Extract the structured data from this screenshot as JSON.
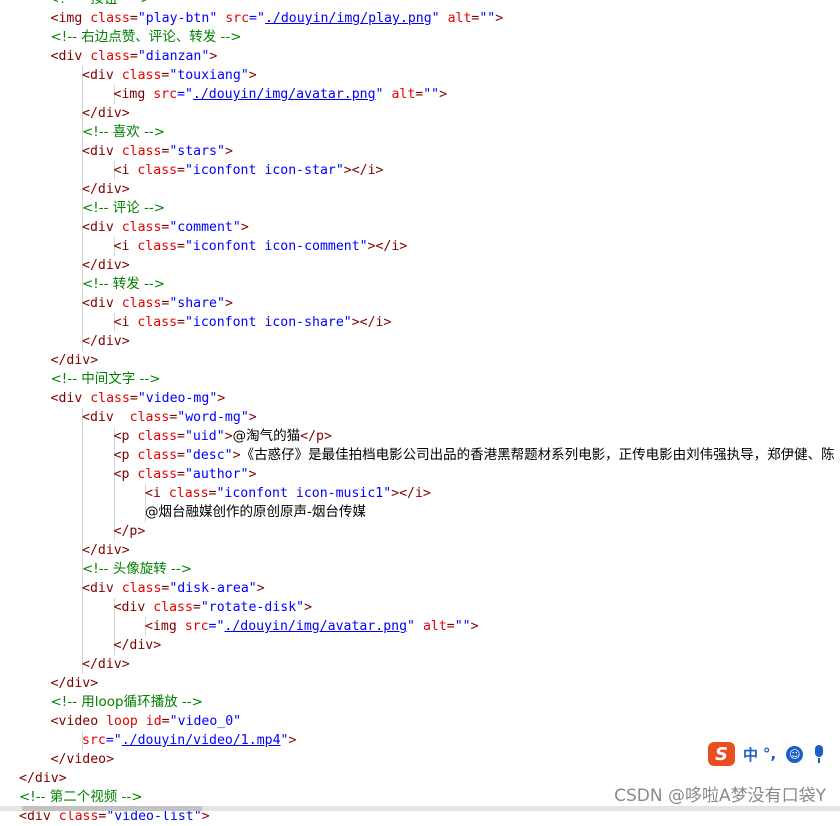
{
  "editor": {
    "lines": [
      {
        "indent": 1,
        "tokens": [
          {
            "t": "<!-- ",
            "c": "comment"
          },
          {
            "t": "按钮",
            "c": "comment"
          },
          {
            "t": " -->",
            "c": "comment"
          }
        ]
      },
      {
        "indent": 1,
        "tokens": [
          {
            "t": "<img ",
            "c": "tag"
          },
          {
            "t": "class",
            "c": "attr"
          },
          {
            "t": "=",
            "c": "tag"
          },
          {
            "t": "\"play-btn\"",
            "c": "str"
          },
          {
            "t": " ",
            "c": "tag"
          },
          {
            "t": "src",
            "c": "attr"
          },
          {
            "t": "=\"",
            "c": "str"
          },
          {
            "t": "./douyin/img/play.png",
            "c": "link"
          },
          {
            "t": "\"",
            "c": "str"
          },
          {
            "t": " ",
            "c": "tag"
          },
          {
            "t": "alt",
            "c": "attr"
          },
          {
            "t": "=",
            "c": "tag"
          },
          {
            "t": "\"\"",
            "c": "str"
          },
          {
            "t": ">",
            "c": "tag"
          }
        ]
      },
      {
        "indent": 1,
        "tokens": [
          {
            "t": "<!-- 右边点赞、评论、转发 -->",
            "c": "comment"
          }
        ]
      },
      {
        "indent": 1,
        "tokens": [
          {
            "t": "<div ",
            "c": "tag"
          },
          {
            "t": "class",
            "c": "attr"
          },
          {
            "t": "=",
            "c": "tag"
          },
          {
            "t": "\"dianzan\"",
            "c": "str"
          },
          {
            "t": ">",
            "c": "tag"
          }
        ]
      },
      {
        "indent": 2,
        "tokens": [
          {
            "t": "<div ",
            "c": "tag"
          },
          {
            "t": "class",
            "c": "attr"
          },
          {
            "t": "=",
            "c": "tag"
          },
          {
            "t": "\"touxiang\"",
            "c": "str"
          },
          {
            "t": ">",
            "c": "tag"
          }
        ]
      },
      {
        "indent": 3,
        "tokens": [
          {
            "t": "<img ",
            "c": "tag"
          },
          {
            "t": "src",
            "c": "attr"
          },
          {
            "t": "=\"",
            "c": "str"
          },
          {
            "t": "./douyin/img/avatar.png",
            "c": "link"
          },
          {
            "t": "\"",
            "c": "str"
          },
          {
            "t": " ",
            "c": "tag"
          },
          {
            "t": "alt",
            "c": "attr"
          },
          {
            "t": "=",
            "c": "tag"
          },
          {
            "t": "\"\"",
            "c": "str"
          },
          {
            "t": ">",
            "c": "tag"
          }
        ]
      },
      {
        "indent": 2,
        "tokens": [
          {
            "t": "</div>",
            "c": "tag"
          }
        ]
      },
      {
        "indent": 2,
        "tokens": [
          {
            "t": "<!-- 喜欢 -->",
            "c": "comment"
          }
        ]
      },
      {
        "indent": 2,
        "tokens": [
          {
            "t": "<div ",
            "c": "tag"
          },
          {
            "t": "class",
            "c": "attr"
          },
          {
            "t": "=",
            "c": "tag"
          },
          {
            "t": "\"stars\"",
            "c": "str"
          },
          {
            "t": ">",
            "c": "tag"
          }
        ]
      },
      {
        "indent": 3,
        "tokens": [
          {
            "t": "<i ",
            "c": "tag"
          },
          {
            "t": "class",
            "c": "attr"
          },
          {
            "t": "=",
            "c": "tag"
          },
          {
            "t": "\"iconfont icon-star\"",
            "c": "str"
          },
          {
            "t": "></i>",
            "c": "tag"
          }
        ]
      },
      {
        "indent": 2,
        "tokens": [
          {
            "t": "</div>",
            "c": "tag"
          }
        ]
      },
      {
        "indent": 2,
        "tokens": [
          {
            "t": "<!-- 评论 -->",
            "c": "comment"
          }
        ]
      },
      {
        "indent": 2,
        "tokens": [
          {
            "t": "<div ",
            "c": "tag"
          },
          {
            "t": "class",
            "c": "attr"
          },
          {
            "t": "=",
            "c": "tag"
          },
          {
            "t": "\"comment\"",
            "c": "str"
          },
          {
            "t": ">",
            "c": "tag"
          }
        ]
      },
      {
        "indent": 3,
        "tokens": [
          {
            "t": "<i ",
            "c": "tag"
          },
          {
            "t": "class",
            "c": "attr"
          },
          {
            "t": "=",
            "c": "tag"
          },
          {
            "t": "\"iconfont icon-comment\"",
            "c": "str"
          },
          {
            "t": "></i>",
            "c": "tag"
          }
        ]
      },
      {
        "indent": 2,
        "tokens": [
          {
            "t": "</div>",
            "c": "tag"
          }
        ]
      },
      {
        "indent": 2,
        "tokens": [
          {
            "t": "<!-- 转发 -->",
            "c": "comment"
          }
        ]
      },
      {
        "indent": 2,
        "tokens": [
          {
            "t": "<div ",
            "c": "tag"
          },
          {
            "t": "class",
            "c": "attr"
          },
          {
            "t": "=",
            "c": "tag"
          },
          {
            "t": "\"share\"",
            "c": "str"
          },
          {
            "t": ">",
            "c": "tag"
          }
        ]
      },
      {
        "indent": 3,
        "tokens": [
          {
            "t": "<i ",
            "c": "tag"
          },
          {
            "t": "class",
            "c": "attr"
          },
          {
            "t": "=",
            "c": "tag"
          },
          {
            "t": "\"iconfont icon-share\"",
            "c": "str"
          },
          {
            "t": "></i>",
            "c": "tag"
          }
        ]
      },
      {
        "indent": 2,
        "tokens": [
          {
            "t": "</div>",
            "c": "tag"
          }
        ]
      },
      {
        "indent": 1,
        "tokens": [
          {
            "t": "</div>",
            "c": "tag"
          }
        ]
      },
      {
        "indent": 1,
        "tokens": [
          {
            "t": "<!-- 中间文字 -->",
            "c": "comment"
          }
        ]
      },
      {
        "indent": 1,
        "tokens": [
          {
            "t": "<div ",
            "c": "tag"
          },
          {
            "t": "class",
            "c": "attr"
          },
          {
            "t": "=",
            "c": "tag"
          },
          {
            "t": "\"video-mg\"",
            "c": "str"
          },
          {
            "t": ">",
            "c": "tag"
          }
        ]
      },
      {
        "indent": 2,
        "tokens": [
          {
            "t": "<div  ",
            "c": "tag"
          },
          {
            "t": "class",
            "c": "attr"
          },
          {
            "t": "=",
            "c": "tag"
          },
          {
            "t": "\"word-mg\"",
            "c": "str"
          },
          {
            "t": ">",
            "c": "tag"
          }
        ]
      },
      {
        "indent": 3,
        "tokens": [
          {
            "t": "<p ",
            "c": "tag"
          },
          {
            "t": "class",
            "c": "attr"
          },
          {
            "t": "=",
            "c": "tag"
          },
          {
            "t": "\"uid\"",
            "c": "str"
          },
          {
            "t": ">",
            "c": "tag"
          },
          {
            "t": "@淘气的猫",
            "c": "text"
          },
          {
            "t": "</p>",
            "c": "tag"
          }
        ]
      },
      {
        "indent": 3,
        "tokens": [
          {
            "t": "<p ",
            "c": "tag"
          },
          {
            "t": "class",
            "c": "attr"
          },
          {
            "t": "=",
            "c": "tag"
          },
          {
            "t": "\"desc\"",
            "c": "str"
          },
          {
            "t": ">",
            "c": "tag"
          },
          {
            "t": "《古惑仔》是最佳拍档电影公司出品的香港黑帮题材系列电影，正传电影由刘伟强执导，郑伊健、陈",
            "c": "text"
          }
        ]
      },
      {
        "indent": 3,
        "tokens": [
          {
            "t": "<p ",
            "c": "tag"
          },
          {
            "t": "class",
            "c": "attr"
          },
          {
            "t": "=",
            "c": "tag"
          },
          {
            "t": "\"author\"",
            "c": "str"
          },
          {
            "t": ">",
            "c": "tag"
          }
        ]
      },
      {
        "indent": 4,
        "tokens": [
          {
            "t": "<i ",
            "c": "tag"
          },
          {
            "t": "class",
            "c": "attr"
          },
          {
            "t": "=",
            "c": "tag"
          },
          {
            "t": "\"iconfont icon-music1\"",
            "c": "str"
          },
          {
            "t": "></i>",
            "c": "tag"
          }
        ]
      },
      {
        "indent": 4,
        "tokens": [
          {
            "t": "@烟台融媒创作的原创原声-烟台传媒",
            "c": "text"
          }
        ]
      },
      {
        "indent": 3,
        "tokens": [
          {
            "t": "</p>",
            "c": "tag"
          }
        ]
      },
      {
        "indent": 2,
        "tokens": [
          {
            "t": "</div>",
            "c": "tag"
          }
        ]
      },
      {
        "indent": 2,
        "tokens": [
          {
            "t": "<!-- 头像旋转 -->",
            "c": "comment"
          }
        ]
      },
      {
        "indent": 2,
        "tokens": [
          {
            "t": "<div ",
            "c": "tag"
          },
          {
            "t": "class",
            "c": "attr"
          },
          {
            "t": "=",
            "c": "tag"
          },
          {
            "t": "\"disk-area\"",
            "c": "str"
          },
          {
            "t": ">",
            "c": "tag"
          }
        ]
      },
      {
        "indent": 3,
        "tokens": [
          {
            "t": "<div ",
            "c": "tag"
          },
          {
            "t": "class",
            "c": "attr"
          },
          {
            "t": "=",
            "c": "tag"
          },
          {
            "t": "\"rotate-disk\"",
            "c": "str"
          },
          {
            "t": ">",
            "c": "tag"
          }
        ]
      },
      {
        "indent": 4,
        "tokens": [
          {
            "t": "<img ",
            "c": "tag"
          },
          {
            "t": "src",
            "c": "attr"
          },
          {
            "t": "=\"",
            "c": "str"
          },
          {
            "t": "./douyin/img/avatar.png",
            "c": "link"
          },
          {
            "t": "\"",
            "c": "str"
          },
          {
            "t": " ",
            "c": "tag"
          },
          {
            "t": "alt",
            "c": "attr"
          },
          {
            "t": "=",
            "c": "tag"
          },
          {
            "t": "\"\"",
            "c": "str"
          },
          {
            "t": ">",
            "c": "tag"
          }
        ]
      },
      {
        "indent": 3,
        "tokens": [
          {
            "t": "</div>",
            "c": "tag"
          }
        ]
      },
      {
        "indent": 2,
        "tokens": [
          {
            "t": "</div>",
            "c": "tag"
          }
        ]
      },
      {
        "indent": 1,
        "tokens": [
          {
            "t": "</div>",
            "c": "tag"
          }
        ]
      },
      {
        "indent": 1,
        "tokens": [
          {
            "t": "<!-- 用loop循环播放 -->",
            "c": "comment"
          }
        ]
      },
      {
        "indent": 1,
        "tokens": [
          {
            "t": "<video ",
            "c": "tag"
          },
          {
            "t": "loop ",
            "c": "attr"
          },
          {
            "t": "id",
            "c": "attr"
          },
          {
            "t": "=",
            "c": "tag"
          },
          {
            "t": "\"video_0\"",
            "c": "str"
          }
        ]
      },
      {
        "indent": 2,
        "tokens": [
          {
            "t": "src",
            "c": "attr"
          },
          {
            "t": "=\"",
            "c": "str"
          },
          {
            "t": "./douyin/video/1.mp4",
            "c": "link"
          },
          {
            "t": "\"",
            "c": "str"
          },
          {
            "t": ">",
            "c": "tag"
          }
        ]
      },
      {
        "indent": 1,
        "tokens": [
          {
            "t": "</video>",
            "c": "tag"
          }
        ]
      },
      {
        "indent": 0,
        "tokens": [
          {
            "t": "</div>",
            "c": "tag"
          }
        ]
      },
      {
        "indent": 0,
        "tokens": [
          {
            "t": "<!-- 第二个视频 -->",
            "c": "comment"
          }
        ]
      },
      {
        "indent": 0,
        "tokens": [
          {
            "t": "<div ",
            "c": "tag"
          },
          {
            "t": "class",
            "c": "attr"
          },
          {
            "t": "=",
            "c": "tag"
          },
          {
            "t": "\"video-list\"",
            "c": "str"
          },
          {
            "t": ">",
            "c": "tag"
          }
        ]
      }
    ]
  },
  "ime": {
    "logo_glyph": "S",
    "mode_label": "中",
    "punct_label": "°,",
    "emoji_icon": "smiley-icon",
    "voice_icon": "microphone-icon",
    "accent_color": "#1d5fc8",
    "logo_color": "#ea4d20"
  },
  "watermark": {
    "text": "CSDN @哆啦A梦没有口袋Y"
  }
}
